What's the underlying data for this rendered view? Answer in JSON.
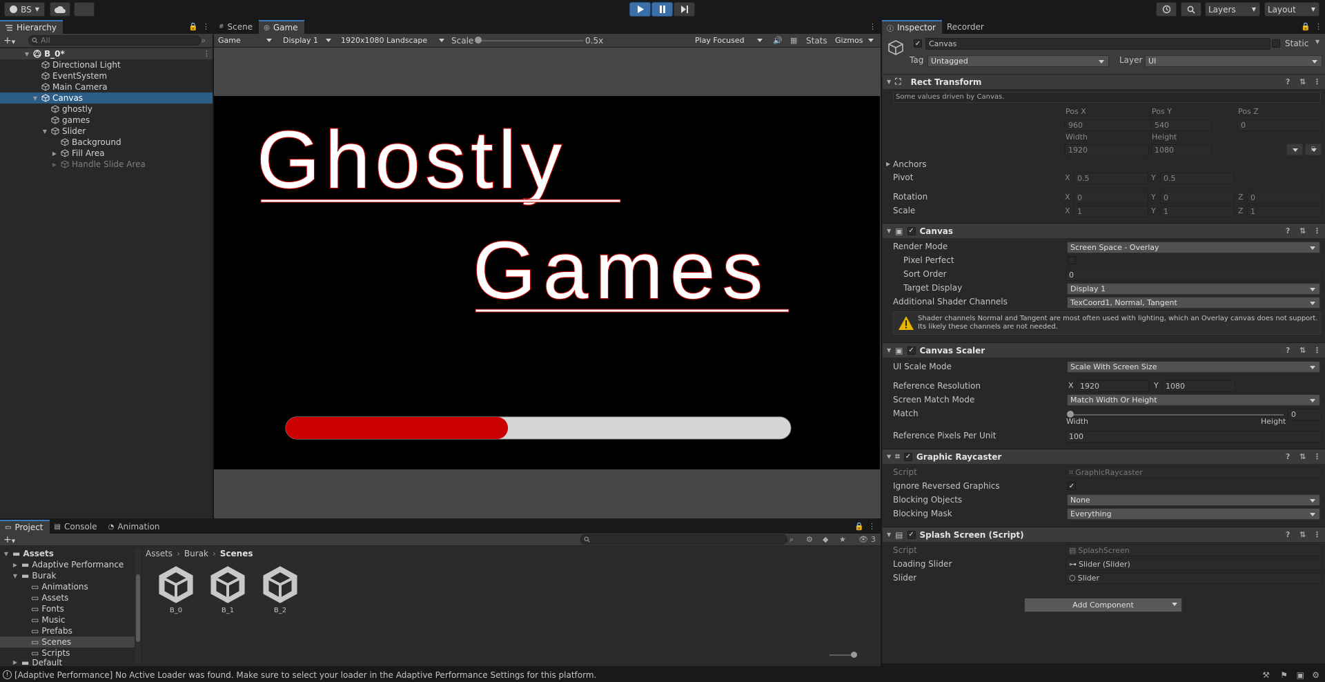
{
  "toolbar": {
    "account_label": "BS",
    "layers_label": "Layers",
    "layout_label": "Layout"
  },
  "hierarchy": {
    "tab_label": "Hierarchy",
    "search_placeholder": "All",
    "scene_name": "B_0*",
    "items": [
      {
        "label": "Directional Light"
      },
      {
        "label": "EventSystem"
      },
      {
        "label": "Main Camera"
      },
      {
        "label": "Canvas"
      },
      {
        "label": "ghostly"
      },
      {
        "label": "games"
      },
      {
        "label": "Slider"
      },
      {
        "label": "Background"
      },
      {
        "label": "Fill Area"
      },
      {
        "label": "Handle Slide Area"
      }
    ]
  },
  "view": {
    "tabs": [
      {
        "label": "Scene"
      },
      {
        "label": "Game"
      }
    ],
    "game_dropdown": "Game",
    "display_dropdown": "Display 1",
    "resolution_dropdown": "1920x1080 Landscape",
    "scale_label": "Scale",
    "scale_value": "0.5x",
    "scale_fraction": 0.0,
    "play_focused": "Play Focused",
    "stats_label": "Stats",
    "gizmos_label": "Gizmos",
    "game_title_1": "Ghostly",
    "game_title_2": "Games",
    "slider_progress": 0.44,
    "accent_red": "#cc0000"
  },
  "inspector": {
    "tabs": [
      {
        "label": "Inspector"
      },
      {
        "label": "Recorder"
      }
    ],
    "object_name": "Canvas",
    "static_label": "Static",
    "tag_label": "Tag",
    "tag_value": "Untagged",
    "layer_label": "Layer",
    "layer_value": "UI",
    "rect_transform": {
      "title": "Rect Transform",
      "driven_note": "Some values driven by Canvas.",
      "pos_x_label": "Pos X",
      "pos_y_label": "Pos Y",
      "pos_z_label": "Pos Z",
      "pos_x": "960",
      "pos_y": "540",
      "pos_z": "0",
      "width_label": "Width",
      "height_label": "Height",
      "width": "1920",
      "height": "1080",
      "r_button": "R",
      "anchors_label": "Anchors",
      "pivot_label": "Pivot",
      "pivot_x": "0.5",
      "pivot_y": "0.5",
      "rotation_label": "Rotation",
      "rot_x": "0",
      "rot_y": "0",
      "rot_z": "0",
      "scale_label": "Scale",
      "scale_x": "1",
      "scale_y": "1",
      "scale_z": "1",
      "x": "X",
      "y": "Y",
      "z": "Z"
    },
    "canvas": {
      "title": "Canvas",
      "render_mode_label": "Render Mode",
      "render_mode": "Screen Space - Overlay",
      "pixel_perfect_label": "Pixel Perfect",
      "sort_order_label": "Sort Order",
      "sort_order": "0",
      "target_display_label": "Target Display",
      "target_display": "Display 1",
      "shader_channels_label": "Additional Shader Channels",
      "shader_channels": "TexCoord1, Normal, Tangent",
      "warning": "Shader channels Normal and Tangent are most often used with lighting, which an Overlay canvas does not support. Its likely these channels are not needed."
    },
    "canvas_scaler": {
      "title": "Canvas Scaler",
      "ui_scale_mode_label": "UI Scale Mode",
      "ui_scale_mode": "Scale With Screen Size",
      "ref_res_label": "Reference Resolution",
      "ref_x": "1920",
      "ref_y": "1080",
      "match_mode_label": "Screen Match Mode",
      "match_mode": "Match Width Or Height",
      "match_label": "Match",
      "match_value": "0",
      "match_fraction": 0,
      "width_label": "Width",
      "height_label": "Height",
      "ref_ppu_label": "Reference Pixels Per Unit",
      "ref_ppu": "100"
    },
    "graphic_raycaster": {
      "title": "Graphic Raycaster",
      "script_label": "Script",
      "script": "GraphicRaycaster",
      "ignore_reversed_label": "Ignore Reversed Graphics",
      "blocking_objects_label": "Blocking Objects",
      "blocking_objects": "None",
      "blocking_mask_label": "Blocking Mask",
      "blocking_mask": "Everything"
    },
    "splash_screen": {
      "title": "Splash Screen (Script)",
      "script_label": "Script",
      "script": "SplashScreen",
      "loading_slider_label": "Loading Slider",
      "loading_slider": "Slider (Slider)",
      "slider_label": "Slider",
      "slider": "Slider"
    },
    "add_component": "Add Component"
  },
  "project": {
    "tabs": [
      {
        "label": "Project"
      },
      {
        "label": "Console"
      },
      {
        "label": "Animation"
      }
    ],
    "hidden_count": "3",
    "tree": [
      {
        "label": "Assets"
      },
      {
        "label": "Adaptive Performance"
      },
      {
        "label": "Burak"
      },
      {
        "label": "Animations"
      },
      {
        "label": "Assets"
      },
      {
        "label": "Fonts"
      },
      {
        "label": "Music"
      },
      {
        "label": "Prefabs"
      },
      {
        "label": "Scenes"
      },
      {
        "label": "Scripts"
      },
      {
        "label": "Default"
      }
    ],
    "breadcrumb": [
      "Assets",
      "Burak",
      "Scenes"
    ],
    "assets": [
      {
        "label": "B_0"
      },
      {
        "label": "B_1"
      },
      {
        "label": "B_2"
      }
    ]
  },
  "status": {
    "message": "[Adaptive Performance] No Active Loader was found. Make sure to select your loader in the Adaptive Performance Settings for this platform."
  }
}
